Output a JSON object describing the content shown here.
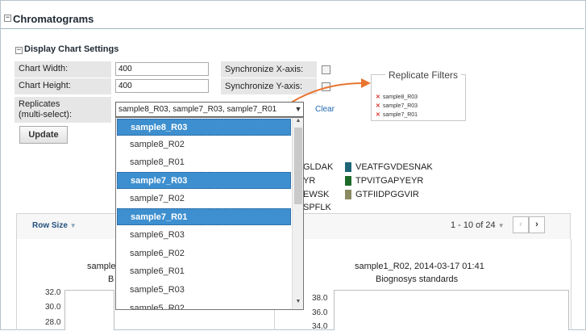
{
  "section": {
    "title": "Chromatograms"
  },
  "settings": {
    "title": "Display Chart Settings",
    "chart_width_label": "Chart Width:",
    "chart_width_value": "400",
    "chart_height_label": "Chart Height:",
    "chart_height_value": "400",
    "sync_x_label": "Synchronize X-axis:",
    "sync_y_label": "Synchronize Y-axis:",
    "replicates_label_1": "Replicates",
    "replicates_label_2": "(multi-select):",
    "replicates_value": "sample8_R03, sample7_R03, sample7_R01",
    "clear_label": "Clear",
    "update_label": "Update"
  },
  "dropdown": {
    "options": [
      {
        "label": "sample8_R03",
        "selected": true
      },
      {
        "label": "sample8_R02",
        "selected": false
      },
      {
        "label": "sample8_R01",
        "selected": false
      },
      {
        "label": "sample7_R03",
        "selected": true
      },
      {
        "label": "sample7_R02",
        "selected": false
      },
      {
        "label": "sample7_R01",
        "selected": true
      },
      {
        "label": "sample6_R03",
        "selected": false
      },
      {
        "label": "sample6_R02",
        "selected": false
      },
      {
        "label": "sample6_R01",
        "selected": false
      },
      {
        "label": "sample5_R03",
        "selected": false
      },
      {
        "label": "sample5_R02",
        "selected": false
      }
    ]
  },
  "replicate_filters": {
    "title": "Replicate Filters",
    "items": [
      "sample8_R03",
      "sample7_R03",
      "sample7_R01"
    ],
    "remove_color": "#d9332b"
  },
  "peptides": {
    "left_partial": [
      "GLDAK",
      "YR",
      "EWSK",
      "SPFLK"
    ],
    "right": [
      {
        "label": "VEATFGVDESNAK",
        "color": "#1e6677"
      },
      {
        "label": "TPVITGAPYEYR",
        "color": "#1d6b2a"
      },
      {
        "label": "GTFIIDPGGVIR",
        "color": "#8c8a62"
      }
    ]
  },
  "grid": {
    "row_size_label": "Row Size",
    "pager_text": "1 - 10 of 24",
    "prev_icon": "chevron-left-icon",
    "next_icon": "chevron-right-icon"
  },
  "charts": {
    "left": {
      "title_partial": "sample",
      "subtitle_partial": "B",
      "ticks": [
        "32.0",
        "30.0",
        "28.0"
      ]
    },
    "right": {
      "title": "sample1_R02, 2014-03-17 01:41",
      "subtitle": "Biognosys standards",
      "ticks": [
        "38.0",
        "36.0",
        "34.0"
      ]
    }
  },
  "colors": {
    "selection": "#3d8fcf",
    "link": "#1e66b1",
    "callout_arrow": "#e87530"
  }
}
